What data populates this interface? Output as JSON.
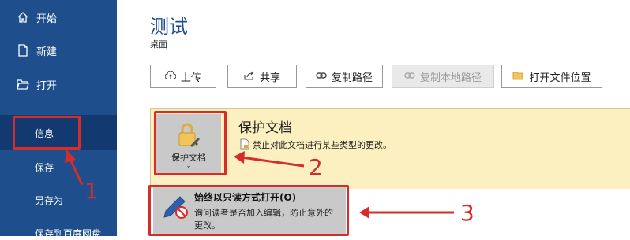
{
  "sidebar": {
    "items": [
      {
        "label": "开始",
        "icon": "home-icon"
      },
      {
        "label": "新建",
        "icon": "new-document-icon"
      },
      {
        "label": "打开",
        "icon": "open-folder-icon"
      }
    ],
    "selected_label": "信息",
    "sub_items": [
      "保存",
      "另存为",
      "保存到百度网盘"
    ]
  },
  "main": {
    "title": "测试",
    "location": "桌面",
    "buttons": [
      {
        "label": "上传",
        "icon": "upload-icon",
        "enabled": true
      },
      {
        "label": "共享",
        "icon": "share-icon",
        "enabled": true
      },
      {
        "label": "复制路径",
        "icon": "link-icon",
        "enabled": true
      },
      {
        "label": "复制本地路径",
        "icon": "link-icon",
        "enabled": false
      },
      {
        "label": "打开文件位置",
        "icon": "folder-icon",
        "enabled": true
      }
    ],
    "protect": {
      "button_label": "保护文档",
      "caret": "⌄",
      "title": "保护文档",
      "description": "禁止对此文档进行某些类型的更改。"
    },
    "dropdown": {
      "title": "始终以只读方式打开(O)",
      "description": "询问读者是否加入编辑，防止意外的更改。"
    }
  },
  "annotations": {
    "numbers": [
      "1",
      "2",
      "3"
    ],
    "color": "#d62c2c"
  },
  "colors": {
    "sidebar": "#1e4e8c",
    "protect_bg": "#fdf0c0",
    "accent": "#d62c2c"
  }
}
